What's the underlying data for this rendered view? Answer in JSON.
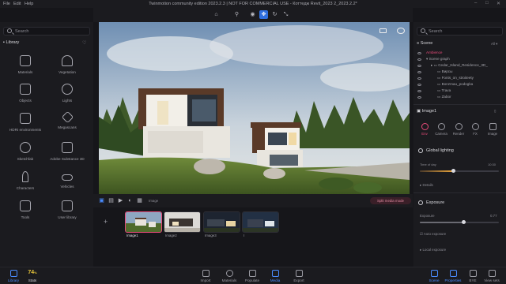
{
  "titlebar": {
    "menus": [
      "File",
      "Edit",
      "Help"
    ],
    "title": "Twinmotion community edition 2023.2.3 | NOT FOR COMMERCIAL USE - Коттедж Revit_2023 2_2023.2.2*"
  },
  "left_panel": {
    "search_placeholder": "Search",
    "heading": "Library",
    "items": [
      {
        "label": "Materials"
      },
      {
        "label": "Vegetation"
      },
      {
        "label": "Objects"
      },
      {
        "label": "Lights"
      },
      {
        "label": "HDRI environments"
      },
      {
        "label": "Megascans"
      },
      {
        "label": "Sketchfab"
      },
      {
        "label": "Adobe Substance 3D"
      },
      {
        "label": "Characters"
      },
      {
        "label": "Vehicles"
      },
      {
        "label": "Tools"
      },
      {
        "label": "User library"
      }
    ]
  },
  "media_bar": {
    "label": "Image",
    "split_button": "Split media mode"
  },
  "thumbnails": [
    {
      "label": "Image1"
    },
    {
      "label": "Image2"
    },
    {
      "label": "Image3"
    },
    {
      "label": "I"
    }
  ],
  "right_panel": {
    "search_placeholder": "Search",
    "scene_heading": "Scene",
    "scene_filter": "All",
    "scene_items": [
      {
        "label": "Ambience",
        "accent": true
      },
      {
        "label": "Scene graph"
      },
      {
        "label": "Cedar_Island_Residence_3D_"
      },
      {
        "label": "Вирсы"
      },
      {
        "label": "Fonts_on_stroiteety"
      },
      {
        "label": "Bonzmau_podogka"
      },
      {
        "label": "Trava"
      },
      {
        "label": "Zabor"
      }
    ],
    "image_heading": "Image1",
    "tabs": [
      {
        "label": "Env",
        "active": true
      },
      {
        "label": "Camera"
      },
      {
        "label": "Render"
      },
      {
        "label": "FX"
      },
      {
        "label": "Image"
      }
    ],
    "global_lighting": "Global lighting",
    "time_of_day_label": "Time of day",
    "time_of_day_value": "10:30",
    "details_label": "Details",
    "exposure_heading": "Exposure",
    "exposure_label": "Exposure",
    "exposure_value": "0.77",
    "auto_exposure": "Auto exposure",
    "local_exposure": "Local exposure"
  },
  "bottom_bar": {
    "library": "Library",
    "stats_value": "74",
    "stats_unit": "%",
    "stats_label": "Stats",
    "nav": [
      {
        "label": "Import"
      },
      {
        "label": "Materials"
      },
      {
        "label": "Populate"
      },
      {
        "label": "Media",
        "active": true
      },
      {
        "label": "Export"
      }
    ],
    "right_nav": [
      {
        "label": "Scene",
        "active": true
      },
      {
        "label": "Properties",
        "active": true
      },
      {
        "label": "BYE"
      },
      {
        "label": "View sets"
      }
    ]
  },
  "colors": {
    "accent_pink": "#e84b7a",
    "accent_blue": "#4a8cff",
    "stats_yellow": "#e8c53a"
  }
}
